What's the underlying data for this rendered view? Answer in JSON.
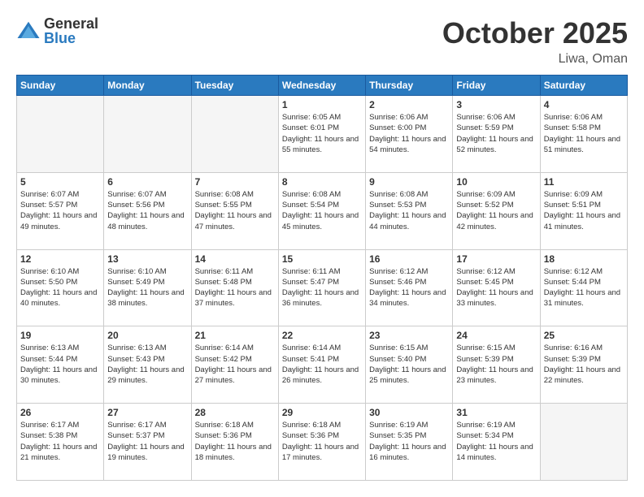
{
  "header": {
    "logo_general": "General",
    "logo_blue": "Blue",
    "month_title": "October 2025",
    "location": "Liwa, Oman"
  },
  "weekdays": [
    "Sunday",
    "Monday",
    "Tuesday",
    "Wednesday",
    "Thursday",
    "Friday",
    "Saturday"
  ],
  "weeks": [
    [
      {
        "day": "",
        "info": "",
        "empty": true
      },
      {
        "day": "",
        "info": "",
        "empty": true
      },
      {
        "day": "",
        "info": "",
        "empty": true
      },
      {
        "day": "1",
        "info": "Sunrise: 6:05 AM\nSunset: 6:01 PM\nDaylight: 11 hours and 55 minutes."
      },
      {
        "day": "2",
        "info": "Sunrise: 6:06 AM\nSunset: 6:00 PM\nDaylight: 11 hours and 54 minutes."
      },
      {
        "day": "3",
        "info": "Sunrise: 6:06 AM\nSunset: 5:59 PM\nDaylight: 11 hours and 52 minutes."
      },
      {
        "day": "4",
        "info": "Sunrise: 6:06 AM\nSunset: 5:58 PM\nDaylight: 11 hours and 51 minutes."
      }
    ],
    [
      {
        "day": "5",
        "info": "Sunrise: 6:07 AM\nSunset: 5:57 PM\nDaylight: 11 hours and 49 minutes."
      },
      {
        "day": "6",
        "info": "Sunrise: 6:07 AM\nSunset: 5:56 PM\nDaylight: 11 hours and 48 minutes."
      },
      {
        "day": "7",
        "info": "Sunrise: 6:08 AM\nSunset: 5:55 PM\nDaylight: 11 hours and 47 minutes."
      },
      {
        "day": "8",
        "info": "Sunrise: 6:08 AM\nSunset: 5:54 PM\nDaylight: 11 hours and 45 minutes."
      },
      {
        "day": "9",
        "info": "Sunrise: 6:08 AM\nSunset: 5:53 PM\nDaylight: 11 hours and 44 minutes."
      },
      {
        "day": "10",
        "info": "Sunrise: 6:09 AM\nSunset: 5:52 PM\nDaylight: 11 hours and 42 minutes."
      },
      {
        "day": "11",
        "info": "Sunrise: 6:09 AM\nSunset: 5:51 PM\nDaylight: 11 hours and 41 minutes."
      }
    ],
    [
      {
        "day": "12",
        "info": "Sunrise: 6:10 AM\nSunset: 5:50 PM\nDaylight: 11 hours and 40 minutes."
      },
      {
        "day": "13",
        "info": "Sunrise: 6:10 AM\nSunset: 5:49 PM\nDaylight: 11 hours and 38 minutes."
      },
      {
        "day": "14",
        "info": "Sunrise: 6:11 AM\nSunset: 5:48 PM\nDaylight: 11 hours and 37 minutes."
      },
      {
        "day": "15",
        "info": "Sunrise: 6:11 AM\nSunset: 5:47 PM\nDaylight: 11 hours and 36 minutes."
      },
      {
        "day": "16",
        "info": "Sunrise: 6:12 AM\nSunset: 5:46 PM\nDaylight: 11 hours and 34 minutes."
      },
      {
        "day": "17",
        "info": "Sunrise: 6:12 AM\nSunset: 5:45 PM\nDaylight: 11 hours and 33 minutes."
      },
      {
        "day": "18",
        "info": "Sunrise: 6:12 AM\nSunset: 5:44 PM\nDaylight: 11 hours and 31 minutes."
      }
    ],
    [
      {
        "day": "19",
        "info": "Sunrise: 6:13 AM\nSunset: 5:44 PM\nDaylight: 11 hours and 30 minutes."
      },
      {
        "day": "20",
        "info": "Sunrise: 6:13 AM\nSunset: 5:43 PM\nDaylight: 11 hours and 29 minutes."
      },
      {
        "day": "21",
        "info": "Sunrise: 6:14 AM\nSunset: 5:42 PM\nDaylight: 11 hours and 27 minutes."
      },
      {
        "day": "22",
        "info": "Sunrise: 6:14 AM\nSunset: 5:41 PM\nDaylight: 11 hours and 26 minutes."
      },
      {
        "day": "23",
        "info": "Sunrise: 6:15 AM\nSunset: 5:40 PM\nDaylight: 11 hours and 25 minutes."
      },
      {
        "day": "24",
        "info": "Sunrise: 6:15 AM\nSunset: 5:39 PM\nDaylight: 11 hours and 23 minutes."
      },
      {
        "day": "25",
        "info": "Sunrise: 6:16 AM\nSunset: 5:39 PM\nDaylight: 11 hours and 22 minutes."
      }
    ],
    [
      {
        "day": "26",
        "info": "Sunrise: 6:17 AM\nSunset: 5:38 PM\nDaylight: 11 hours and 21 minutes."
      },
      {
        "day": "27",
        "info": "Sunrise: 6:17 AM\nSunset: 5:37 PM\nDaylight: 11 hours and 19 minutes."
      },
      {
        "day": "28",
        "info": "Sunrise: 6:18 AM\nSunset: 5:36 PM\nDaylight: 11 hours and 18 minutes."
      },
      {
        "day": "29",
        "info": "Sunrise: 6:18 AM\nSunset: 5:36 PM\nDaylight: 11 hours and 17 minutes."
      },
      {
        "day": "30",
        "info": "Sunrise: 6:19 AM\nSunset: 5:35 PM\nDaylight: 11 hours and 16 minutes."
      },
      {
        "day": "31",
        "info": "Sunrise: 6:19 AM\nSunset: 5:34 PM\nDaylight: 11 hours and 14 minutes."
      },
      {
        "day": "",
        "info": "",
        "empty": true
      }
    ]
  ]
}
